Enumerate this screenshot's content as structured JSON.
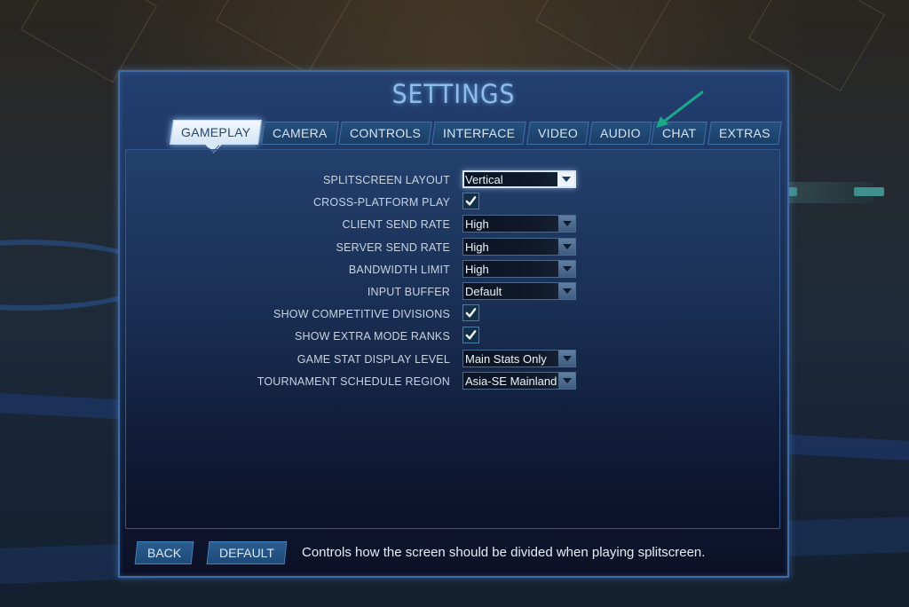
{
  "screen": {
    "title": "SETTINGS"
  },
  "tabs": [
    {
      "label": "GAMEPLAY",
      "active": true
    },
    {
      "label": "CAMERA",
      "active": false
    },
    {
      "label": "CONTROLS",
      "active": false
    },
    {
      "label": "INTERFACE",
      "active": false
    },
    {
      "label": "VIDEO",
      "active": false
    },
    {
      "label": "AUDIO",
      "active": false
    },
    {
      "label": "CHAT",
      "active": false
    },
    {
      "label": "EXTRAS",
      "active": false
    }
  ],
  "annotation": {
    "icon": "arrow-icon",
    "points_to": "CHAT",
    "color": "#1aa88a"
  },
  "settings": [
    {
      "label": "SPLITSCREEN LAYOUT",
      "type": "dropdown",
      "value": "Vertical",
      "focused": true
    },
    {
      "label": "CROSS-PLATFORM PLAY",
      "type": "checkbox",
      "checked": true
    },
    {
      "label": "CLIENT SEND RATE",
      "type": "dropdown",
      "value": "High"
    },
    {
      "label": "SERVER SEND RATE",
      "type": "dropdown",
      "value": "High"
    },
    {
      "label": "BANDWIDTH LIMIT",
      "type": "dropdown",
      "value": "High"
    },
    {
      "label": "INPUT BUFFER",
      "type": "dropdown",
      "value": "Default"
    },
    {
      "label": "SHOW COMPETITIVE DIVISIONS",
      "type": "checkbox",
      "checked": true
    },
    {
      "label": "SHOW EXTRA MODE RANKS",
      "type": "checkbox",
      "checked": true
    },
    {
      "label": "GAME STAT DISPLAY LEVEL",
      "type": "dropdown",
      "value": "Main Stats Only"
    },
    {
      "label": "TOURNAMENT SCHEDULE REGION",
      "type": "dropdown",
      "value": "Asia-SE Mainland"
    }
  ],
  "footer": {
    "back_label": "BACK",
    "default_label": "DEFAULT",
    "help_text": "Controls how the screen should be divided when playing splitscreen."
  },
  "colors": {
    "accent": "#8fbde8",
    "panel": "#1e3764",
    "tab_active": "#e6f1fb",
    "check": "#ffffff"
  }
}
